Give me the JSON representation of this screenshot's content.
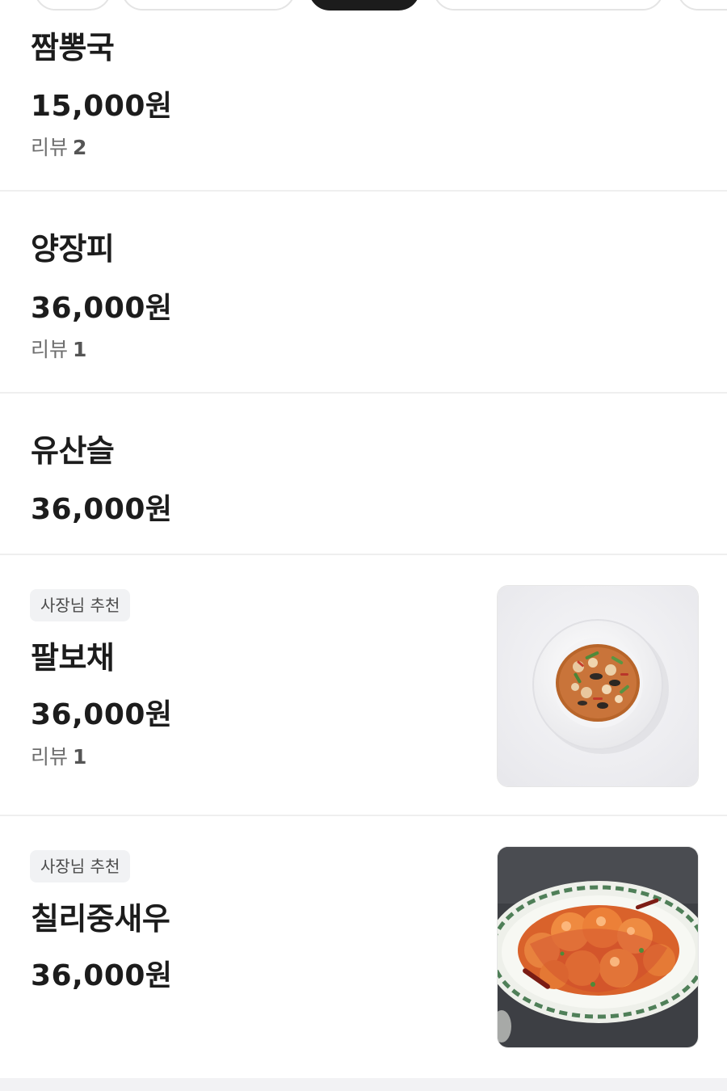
{
  "menu": {
    "items": [
      {
        "name": "짬뽕국",
        "price": "15,000원",
        "review_label": "리뷰",
        "review_count": "2"
      },
      {
        "name": "양장피",
        "price": "36,000원",
        "review_label": "리뷰",
        "review_count": "1"
      },
      {
        "name": "유산슬",
        "price": "36,000원"
      },
      {
        "badge": "사장님 추천",
        "name": "팔보채",
        "price": "36,000원",
        "review_label": "리뷰",
        "review_count": "1",
        "image": "seafood-stirfry-bowl-photo"
      },
      {
        "badge": "사장님 추천",
        "name": "칠리중새우",
        "price": "36,000원",
        "image": "chili-shrimp-plate-photo"
      }
    ]
  },
  "colors": {
    "text_primary": "#1c1c1c",
    "text_secondary": "#6e6e6e",
    "divider": "#efefef",
    "badge_bg": "#f1f2f4",
    "chip_active": "#1c1c1c"
  }
}
